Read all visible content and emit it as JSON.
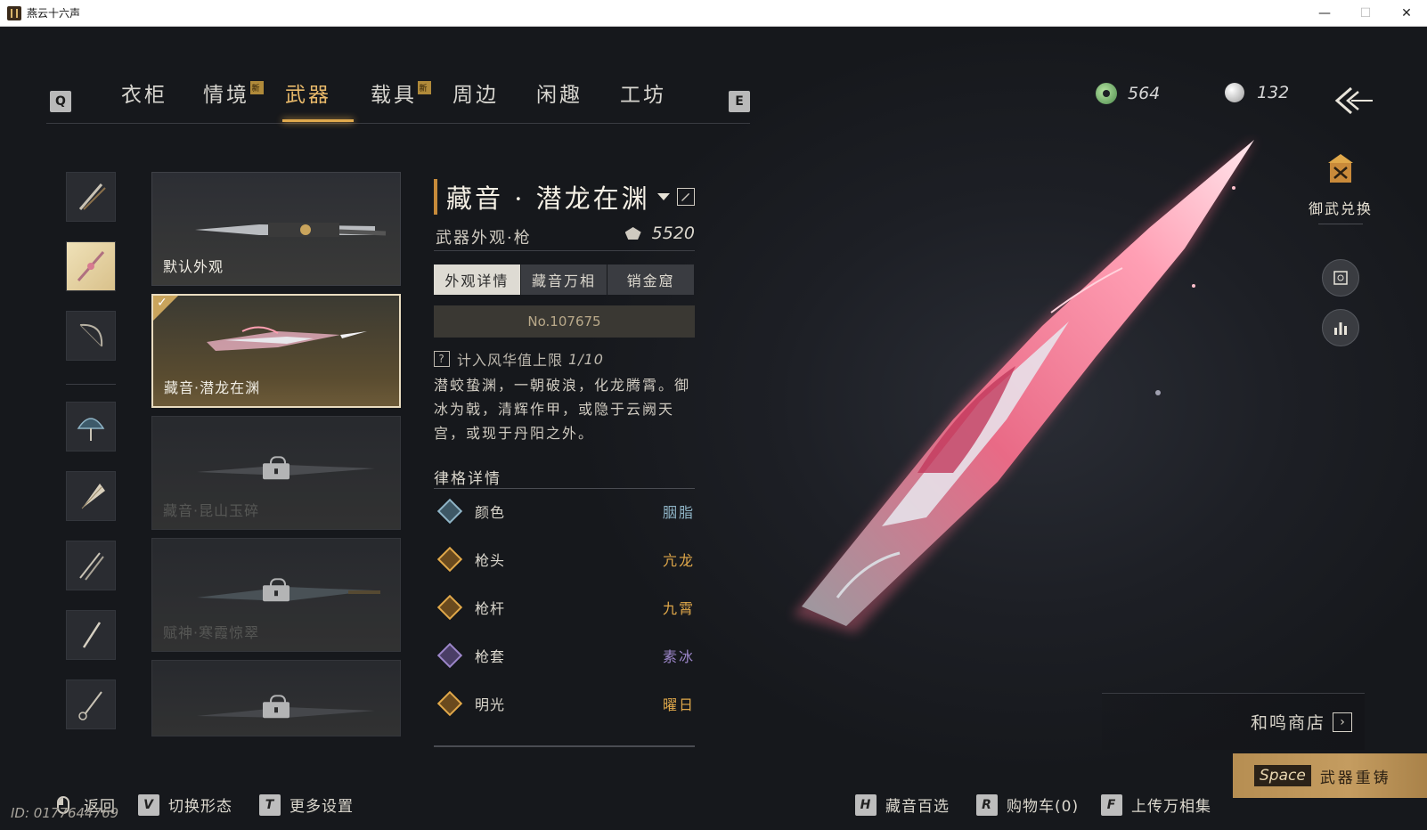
{
  "window": {
    "title": "燕云十六声",
    "min": "—",
    "max": "☐",
    "close": "✕"
  },
  "nav": {
    "left_key": "Q",
    "right_key": "E",
    "tabs": [
      {
        "label": "衣柜"
      },
      {
        "label": "情境",
        "badge": "新"
      },
      {
        "label": "武器",
        "active": true
      },
      {
        "label": "载具",
        "badge": "新"
      },
      {
        "label": "周边"
      },
      {
        "label": "闲趣"
      },
      {
        "label": "工坊"
      }
    ]
  },
  "currency": {
    "jade": "564",
    "pearl": "132"
  },
  "side_categories": [
    {
      "icon": "sword-category-icon"
    },
    {
      "icon": "spear-category-icon",
      "selected": true
    },
    {
      "icon": "bow-category-icon"
    },
    {
      "icon": "umbrella-category-icon"
    },
    {
      "icon": "fan-category-icon"
    },
    {
      "icon": "twin-blade-category-icon"
    },
    {
      "icon": "rope-dart-category-icon"
    },
    {
      "icon": "whip-category-icon"
    }
  ],
  "cards": [
    {
      "label": "默认外观",
      "state": "normal"
    },
    {
      "label": "藏音·潜龙在渊",
      "state": "selected"
    },
    {
      "label": "藏音·昆山玉碎",
      "state": "locked"
    },
    {
      "label": "赋神·寒霞惊翠",
      "state": "locked"
    },
    {
      "label": "",
      "state": "locked"
    }
  ],
  "detail": {
    "title": "藏音 · 潜龙在渊",
    "subtitle": "武器外观·枪",
    "price": "5520",
    "tabs": [
      "外观详情",
      "藏音万相",
      "销金窟"
    ],
    "serial": "No.107675",
    "cap_text": "计入风华值上限",
    "cap_value": "1/10",
    "cap_q": "?",
    "description": "潜蛟蛰渊，一朝破浪，化龙腾霄。御冰为戟，清辉作甲，或隐于云阙天宫，或现于丹阳之外。",
    "section_title": "律格详情",
    "attributes": [
      {
        "name": "颜色",
        "value": "胭脂",
        "color": "#8fb4c6"
      },
      {
        "name": "枪头",
        "value": "亢龙",
        "color": "#e0a84a"
      },
      {
        "name": "枪杆",
        "value": "九霄",
        "color": "#e0a84a"
      },
      {
        "name": "枪套",
        "value": "素冰",
        "color": "#9c86c9"
      },
      {
        "name": "明光",
        "value": "曜日",
        "color": "#e0a84a"
      }
    ]
  },
  "right_rail": {
    "exchange_label": "御武兑换"
  },
  "shop": {
    "label": "和鸣商店"
  },
  "hints": {
    "back": "返回",
    "switch_key": "V",
    "switch": "切换形态",
    "settings_key": "T",
    "settings": "更多设置",
    "collection_key": "H",
    "collection": "藏音百选",
    "cart_key": "R",
    "cart": "购物车(0)",
    "upload_key": "F",
    "upload": "上传万相集",
    "reforge_key": "Space",
    "reforge": "武器重铸"
  },
  "uid": "ID: 0177644769"
}
